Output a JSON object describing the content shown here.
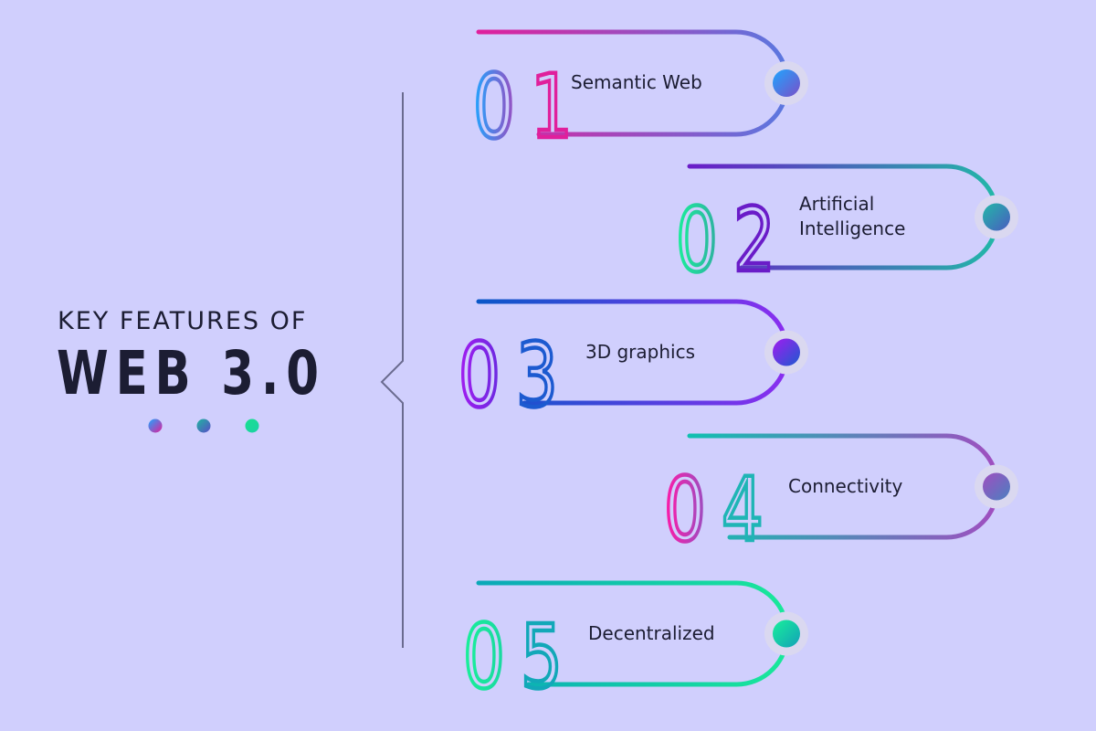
{
  "title": {
    "line1": "KEY FEATURES OF",
    "line2": "WEB 3.0"
  },
  "decor_dots": [
    {
      "from": "#1fa6ff",
      "to": "#e0209c"
    },
    {
      "from": "#1fb5a0",
      "to": "#5a4cc8"
    },
    {
      "from": "#19e08f",
      "to": "#1ad1a5"
    }
  ],
  "background": "#d0cffd",
  "divider_color": "#6a6b8f",
  "features": [
    {
      "number": "01",
      "label": "Semantic Web",
      "num_gradient": [
        "#1fa6ff",
        "#9b4dc0"
      ],
      "digit2_color": "#e0209c",
      "line_gradient": [
        "#e0209c",
        "#5a78e0"
      ],
      "dot_gradient": [
        "#1fa6ff",
        "#7a4fc8"
      ]
    },
    {
      "number": "02",
      "label": "Artificial Intelligence",
      "num_gradient": [
        "#19f09a",
        "#2fb0a0"
      ],
      "digit2_color": "#6a1cc8",
      "line_gradient": [
        "#6a1cc8",
        "#22b8a8"
      ],
      "dot_gradient": [
        "#22b8a8",
        "#4a5cc0"
      ]
    },
    {
      "number": "03",
      "label": "3D graphics",
      "num_gradient": [
        "#a21cf0",
        "#6a2ae0"
      ],
      "digit2_color": "#1c5ad0",
      "line_gradient": [
        "#0a58c8",
        "#8a2ef0"
      ],
      "dot_gradient": [
        "#a21cf0",
        "#1c5ad0"
      ]
    },
    {
      "number": "04",
      "label": "Connectivity",
      "num_gradient": [
        "#ff1aa8",
        "#9a4ec0"
      ],
      "digit2_color": "#1fb5b5",
      "line_gradient": [
        "#10c0b0",
        "#a04ec0"
      ],
      "dot_gradient": [
        "#a04ec0",
        "#4a80c0"
      ]
    },
    {
      "number": "05",
      "label": "Decentralized",
      "num_gradient": [
        "#19f09a",
        "#19d8a0"
      ],
      "digit2_color": "#12a8b8",
      "line_gradient": [
        "#0aa8b8",
        "#19e89a"
      ],
      "dot_gradient": [
        "#19f09a",
        "#12a0b8"
      ]
    }
  ]
}
